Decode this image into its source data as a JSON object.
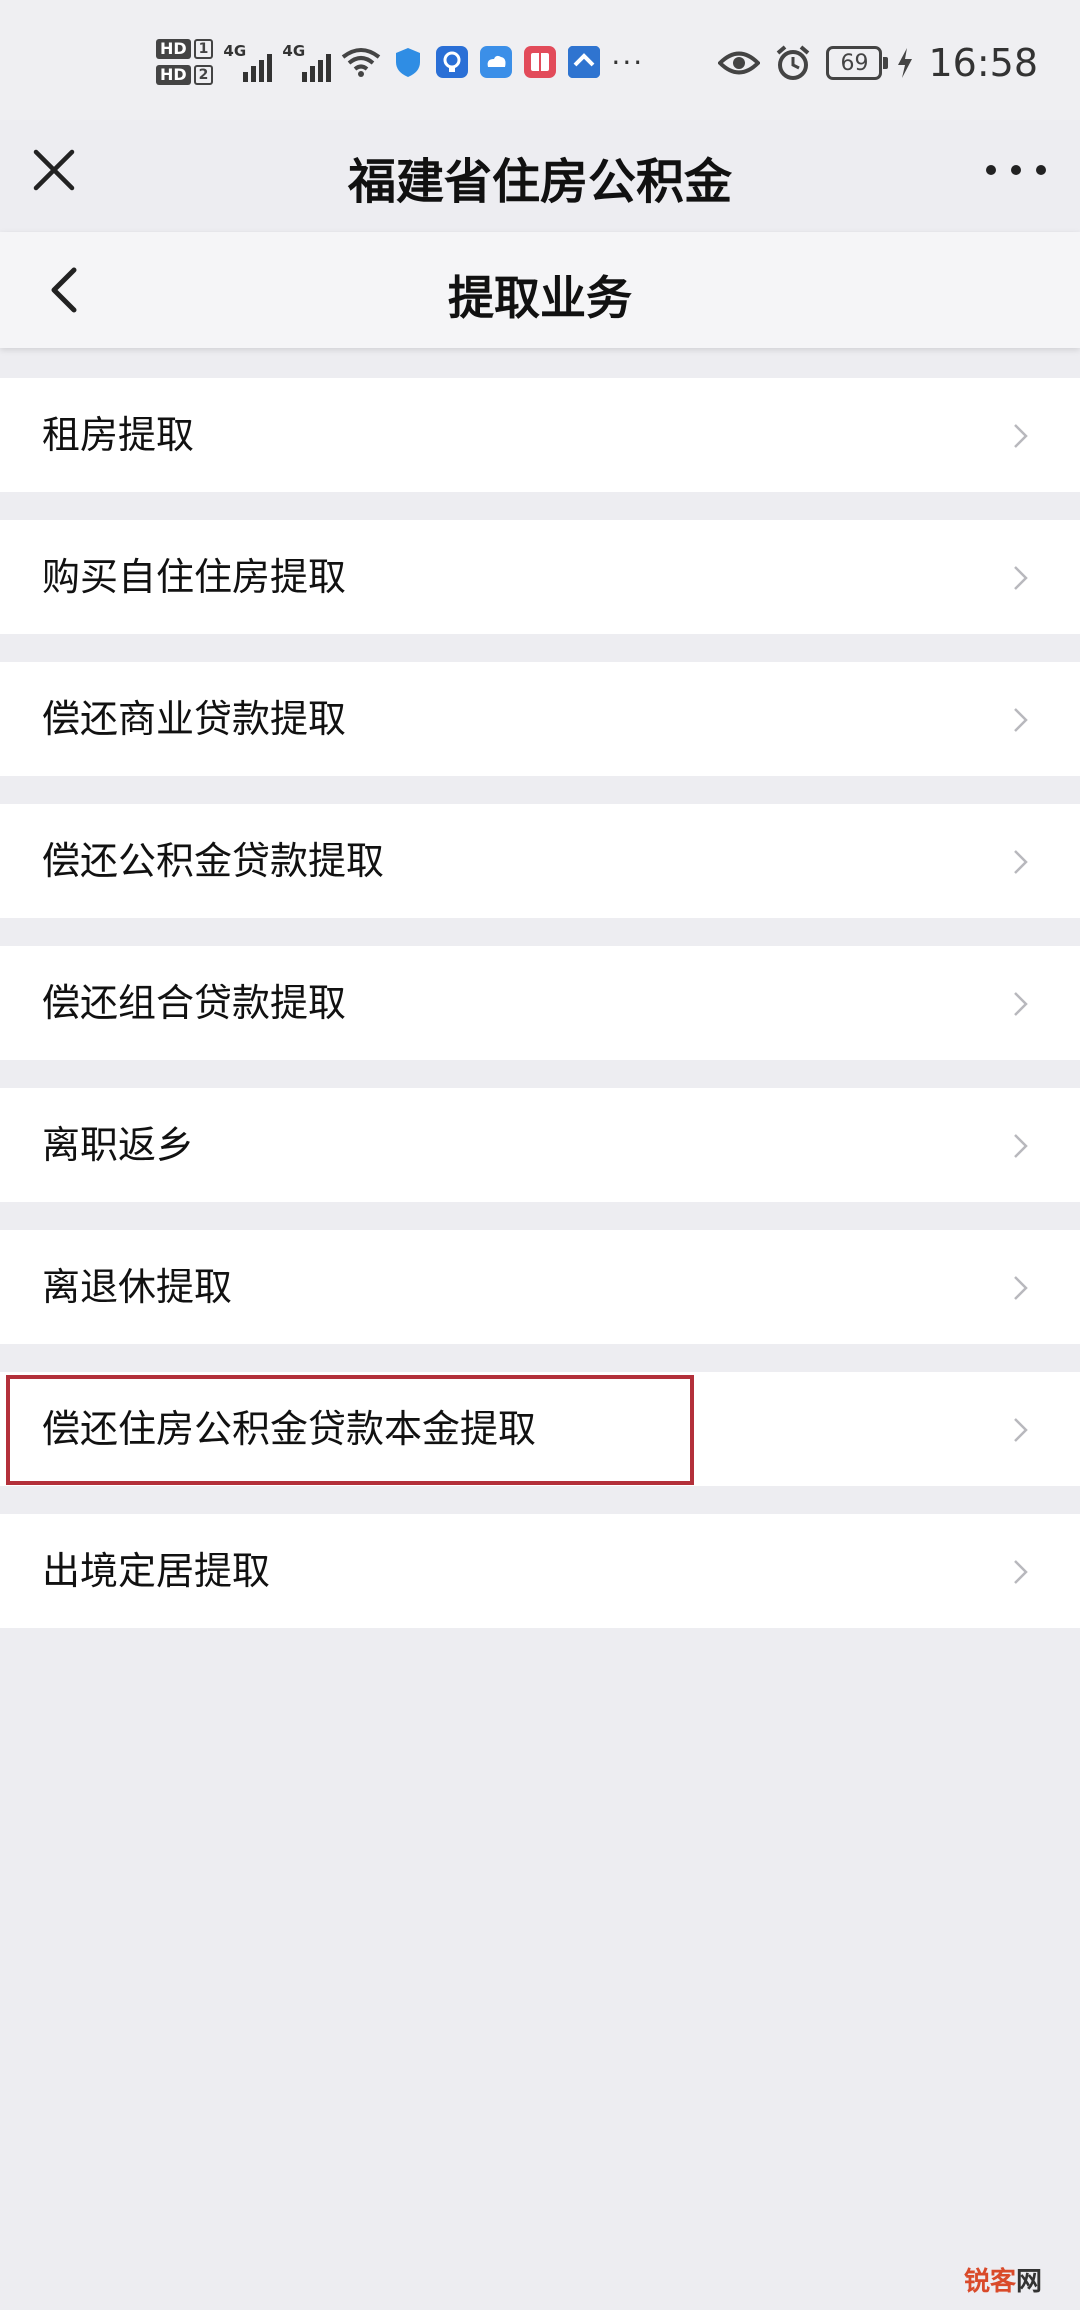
{
  "status_bar": {
    "hd1": "HD",
    "hd1_num": "1",
    "hd2": "HD",
    "hd2_num": "2",
    "network1": "4G",
    "network2": "4G",
    "more": "···",
    "battery": "69",
    "time": "16:58",
    "icons": [
      "eye-icon",
      "alarm-icon"
    ]
  },
  "titlebar": {
    "title": "福建省住房公积金"
  },
  "page": {
    "title": "提取业务"
  },
  "menu": {
    "items": [
      {
        "label": "租房提取"
      },
      {
        "label": "购买自住住房提取"
      },
      {
        "label": "偿还商业贷款提取"
      },
      {
        "label": "偿还公积金贷款提取"
      },
      {
        "label": "偿还组合贷款提取"
      },
      {
        "label": "离职返乡"
      },
      {
        "label": "离退休提取"
      },
      {
        "label": "偿还住房公积金贷款本金提取"
      },
      {
        "label": "出境定居提取"
      }
    ],
    "highlighted_item": "偿还住房公积金贷款本金提取",
    "highlight_color": "#b3303a"
  },
  "watermark": {
    "text1": "锐客",
    "text2": "网"
  }
}
